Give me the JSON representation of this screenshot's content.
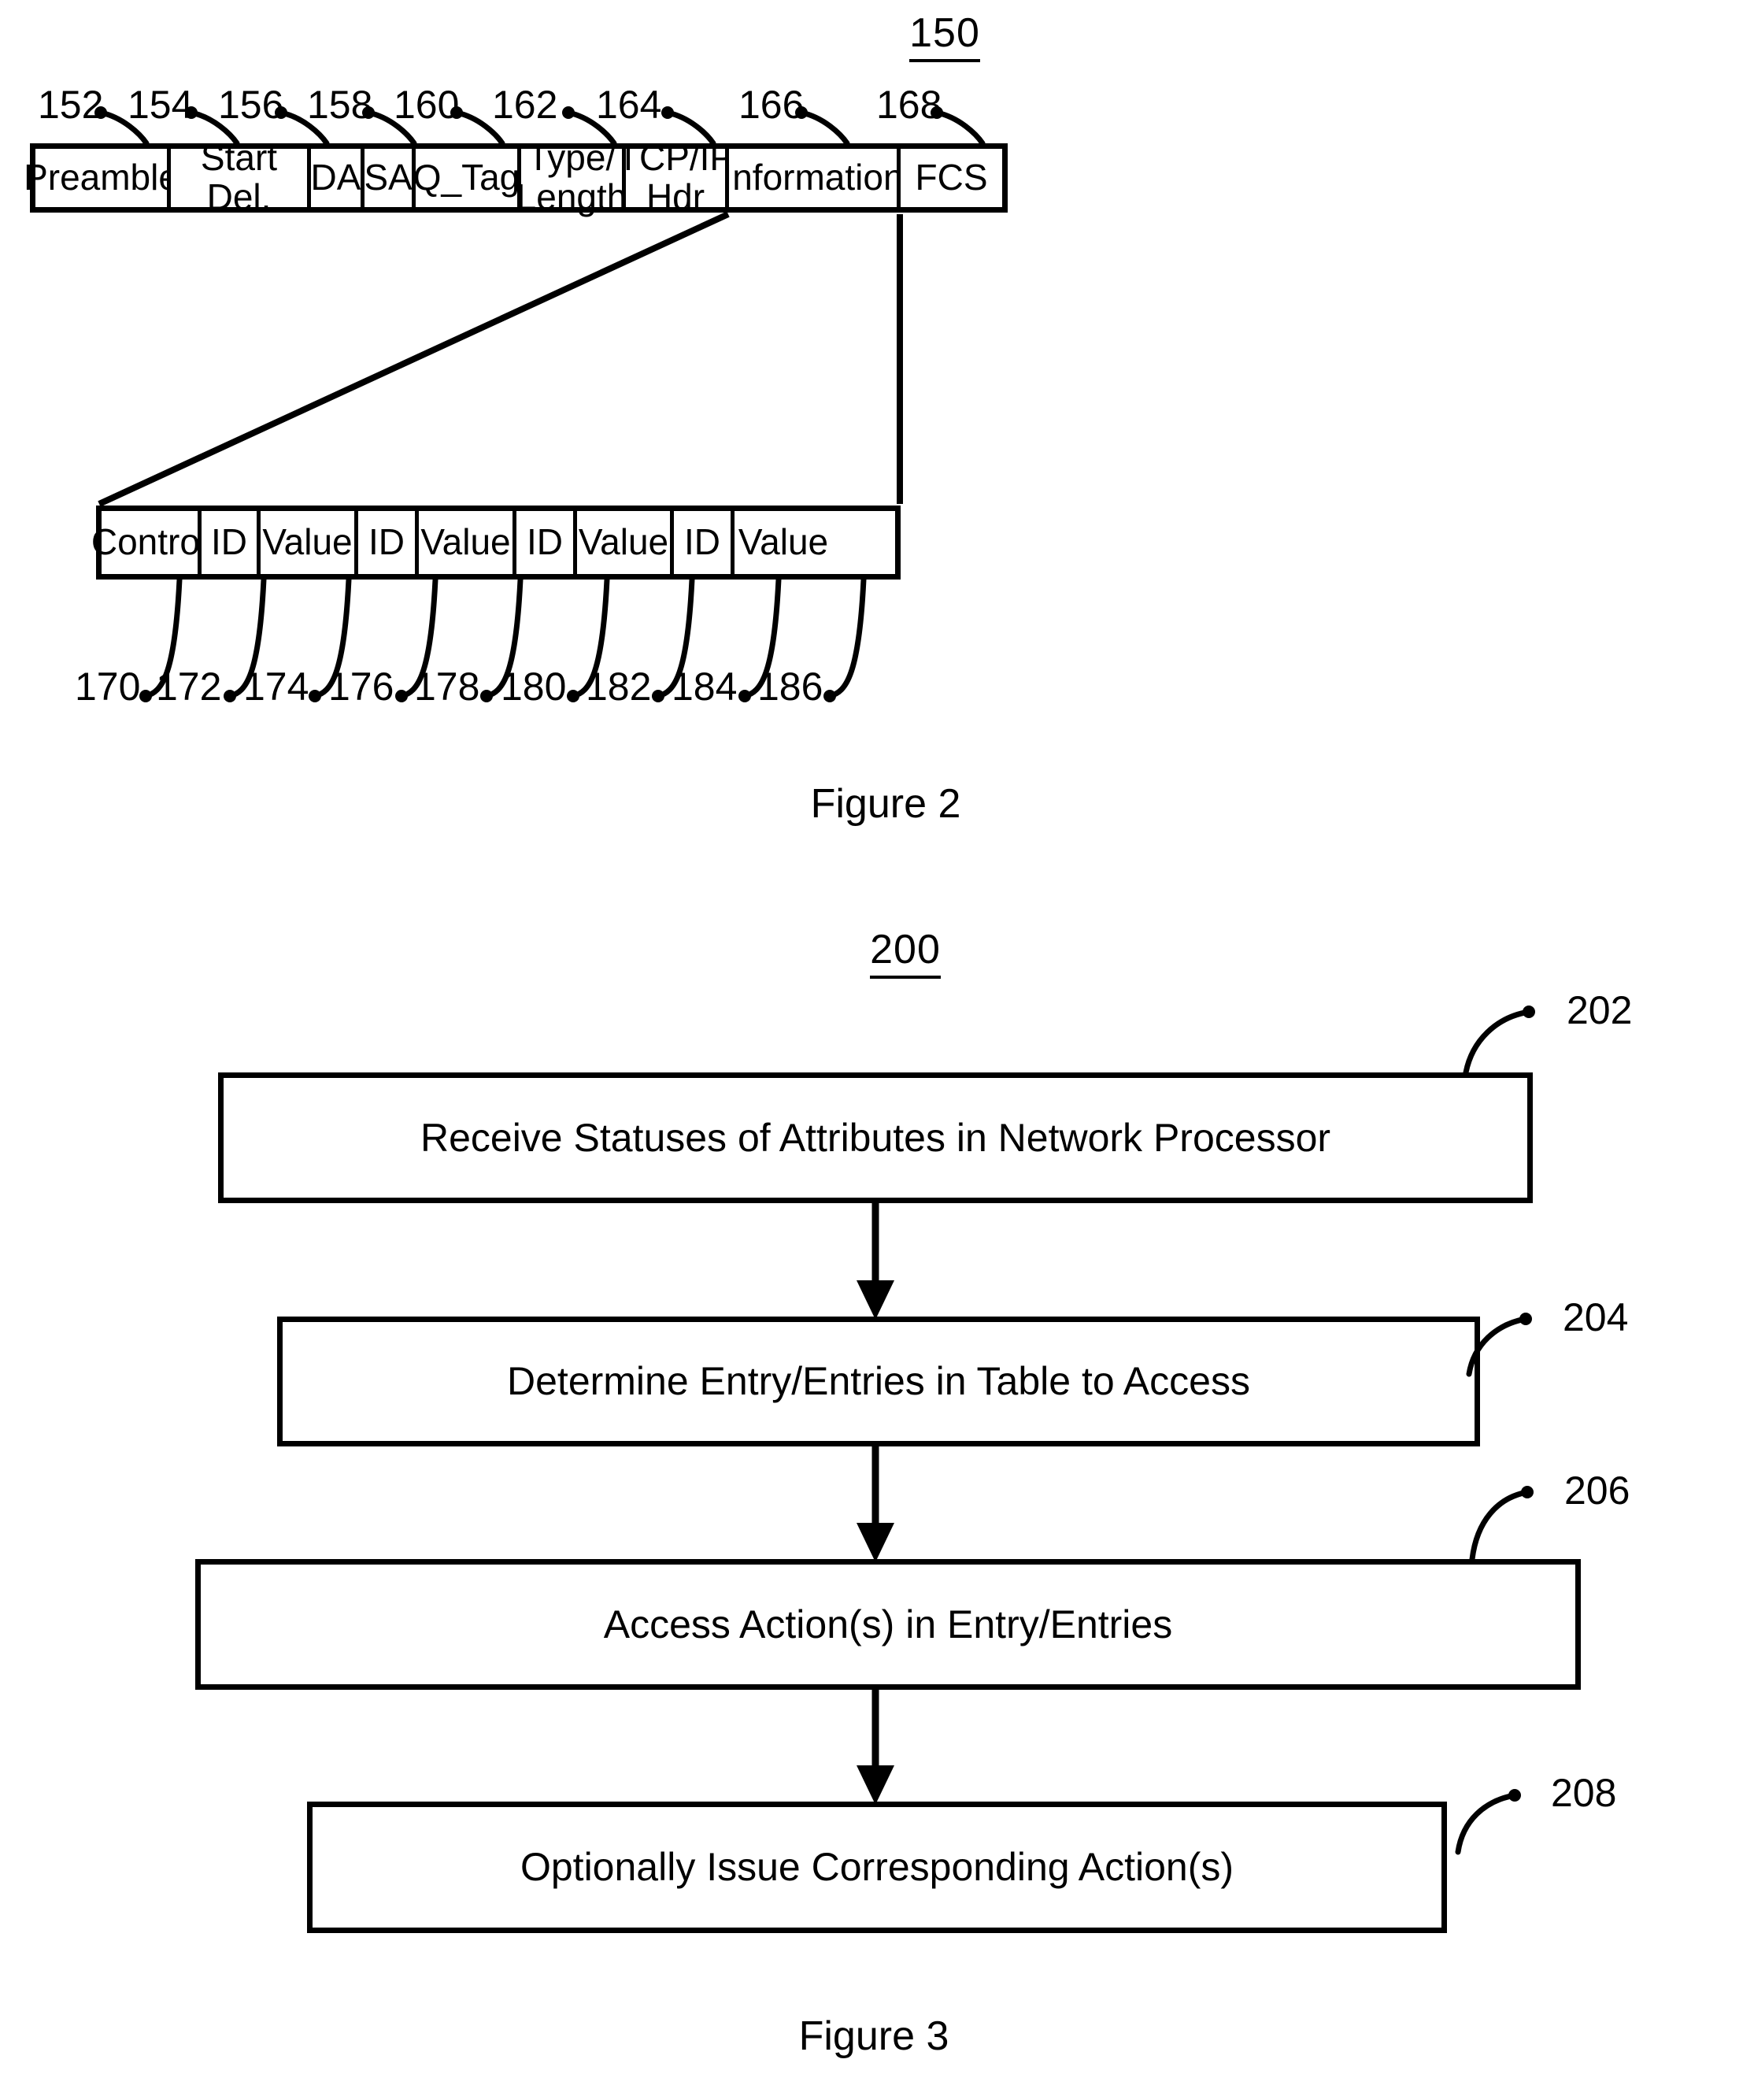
{
  "document": {
    "type": "patent-figure-sheet",
    "figures": [
      "Figure 2",
      "Figure 3"
    ]
  },
  "figure2": {
    "ref_number": "150",
    "caption": "Figure 2",
    "frame_cells": [
      {
        "label": "Preamble",
        "ref": "152"
      },
      {
        "label": "Start Del.",
        "ref": "154"
      },
      {
        "label": "DA",
        "ref": "156"
      },
      {
        "label": "SA",
        "ref": "158"
      },
      {
        "label": "Q_Tag",
        "ref": "160"
      },
      {
        "label": "Type/\nLength",
        "ref": "162"
      },
      {
        "label": "TCP/IP\nHdr",
        "ref": "164"
      },
      {
        "label": "Information",
        "ref": "166"
      },
      {
        "label": "FCS",
        "ref": "168"
      }
    ],
    "top_refs": [
      "152",
      "154",
      "156",
      "158",
      "160",
      "162",
      "164",
      "166",
      "168"
    ],
    "info_cells": [
      {
        "label": "Control",
        "ref": "170"
      },
      {
        "label": "ID",
        "ref": "172"
      },
      {
        "label": "Value",
        "ref": "174"
      },
      {
        "label": "ID",
        "ref": "176"
      },
      {
        "label": "Value",
        "ref": "178"
      },
      {
        "label": "ID",
        "ref": "180"
      },
      {
        "label": "Value",
        "ref": "182"
      },
      {
        "label": "ID",
        "ref": "184"
      },
      {
        "label": "Value",
        "ref": "186"
      }
    ],
    "bottom_refs": [
      "170",
      "172",
      "174",
      "176",
      "178",
      "180",
      "182",
      "184",
      "186"
    ]
  },
  "figure3": {
    "ref_number": "200",
    "caption": "Figure 3",
    "steps": [
      {
        "ref": "202",
        "label": "Receive Statuses of Attributes in Network Processor"
      },
      {
        "ref": "204",
        "label": "Determine Entry/Entries in Table to Access"
      },
      {
        "ref": "206",
        "label": "Access Action(s) in Entry/Entries"
      },
      {
        "ref": "208",
        "label": "Optionally Issue Corresponding Action(s)"
      }
    ]
  },
  "colors": {
    "ink": "#000000",
    "paper": "#ffffff"
  }
}
